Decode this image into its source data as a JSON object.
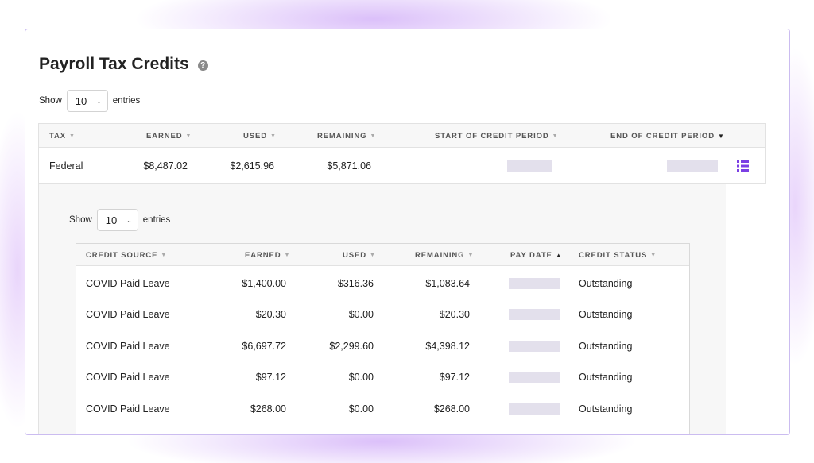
{
  "page": {
    "title": "Payroll Tax Credits",
    "help_glyph": "?"
  },
  "outer_show": {
    "show_label": "Show",
    "entries_value": "10",
    "entries_label": "entries"
  },
  "outer_table": {
    "headers": [
      {
        "label": "TAX",
        "sort": "none"
      },
      {
        "label": "EARNED",
        "sort": "none"
      },
      {
        "label": "USED",
        "sort": "none"
      },
      {
        "label": "REMAINING",
        "sort": "none"
      },
      {
        "label": "START OF CREDIT PERIOD",
        "sort": "none"
      },
      {
        "label": "END OF CREDIT PERIOD",
        "sort": "desc"
      }
    ],
    "rows": [
      {
        "tax": "Federal",
        "earned": "$8,487.02",
        "used": "$2,615.96",
        "remaining": "$5,871.06"
      }
    ]
  },
  "inner_show": {
    "show_label": "Show",
    "entries_value": "10",
    "entries_label": "entries"
  },
  "inner_table": {
    "headers": [
      {
        "label": "CREDIT SOURCE",
        "sort": "none"
      },
      {
        "label": "EARNED",
        "sort": "none"
      },
      {
        "label": "USED",
        "sort": "none"
      },
      {
        "label": "REMAINING",
        "sort": "none"
      },
      {
        "label": "PAY DATE",
        "sort": "asc"
      },
      {
        "label": "CREDIT STATUS",
        "sort": "none"
      }
    ],
    "rows": [
      {
        "source": "COVID Paid Leave",
        "earned": "$1,400.00",
        "used": "$316.36",
        "remaining": "$1,083.64",
        "status": "Outstanding"
      },
      {
        "source": "COVID Paid Leave",
        "earned": "$20.30",
        "used": "$0.00",
        "remaining": "$20.30",
        "status": "Outstanding"
      },
      {
        "source": "COVID Paid Leave",
        "earned": "$6,697.72",
        "used": "$2,299.60",
        "remaining": "$4,398.12",
        "status": "Outstanding"
      },
      {
        "source": "COVID Paid Leave",
        "earned": "$97.12",
        "used": "$0.00",
        "remaining": "$97.12",
        "status": "Outstanding"
      },
      {
        "source": "COVID Paid Leave",
        "earned": "$268.00",
        "used": "$0.00",
        "remaining": "$268.00",
        "status": "Outstanding"
      }
    ]
  },
  "icons": {
    "sort_none": "▼",
    "sort_desc": "▼",
    "sort_asc": "▲",
    "select_chevron": "⌄",
    "details": "list-icon"
  },
  "colors": {
    "accent": "#7b3fe4",
    "card_border": "#cbbcf0",
    "placeholder": "#e3e0ec"
  }
}
